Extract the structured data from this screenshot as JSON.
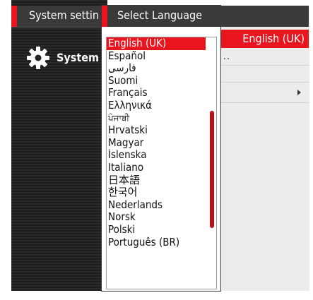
{
  "app": {
    "title": "System settin",
    "section_label": "System",
    "current_language": "English (UK)",
    "dots": "··"
  },
  "dialog": {
    "title": "Select Language",
    "selected_index": 0,
    "languages": [
      "English (UK)",
      "Español",
      "فارسی",
      "Suomi",
      "Français",
      "Ελληνικά",
      "ਪੰਜਾਬੀ",
      "Hrvatski",
      "Magyar",
      "Íslenska",
      "Italiano",
      "日本語",
      "한국어",
      "Nederlands",
      "Norsk",
      "Polski",
      "Português (BR)"
    ]
  },
  "colors": {
    "accent": "#e8141e",
    "header": "#3a3a3a",
    "sidebar": "#222222",
    "panel": "#ececec"
  },
  "icons": {
    "sidebar": "gear-icon",
    "row": "chevron-right-icon"
  }
}
